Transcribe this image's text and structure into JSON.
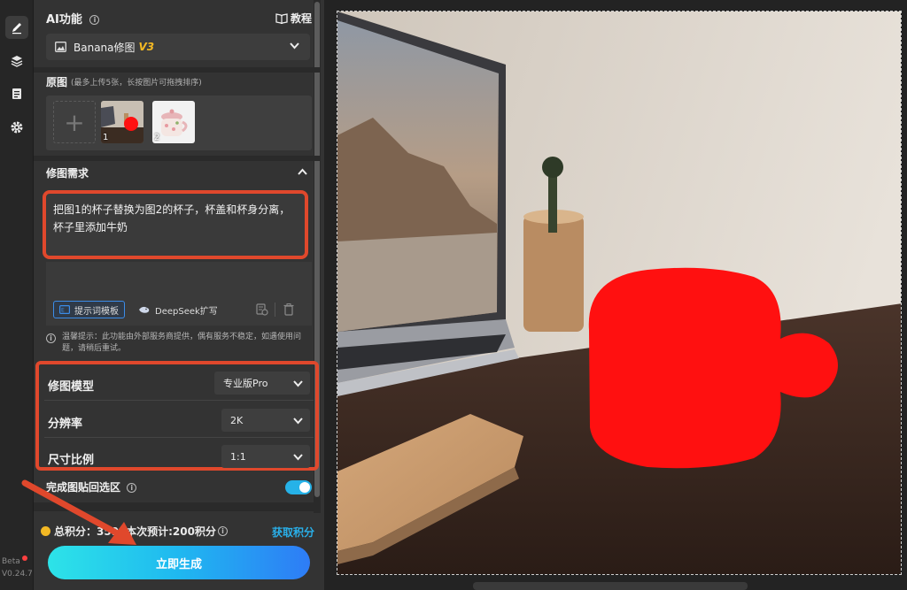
{
  "rail": {
    "items": [
      {
        "icon": "pencil-icon",
        "active": true
      },
      {
        "icon": "layers-icon",
        "active": false
      },
      {
        "icon": "clipboard-icon",
        "active": false
      },
      {
        "icon": "gear-icon",
        "active": false
      }
    ],
    "beta": "Beta",
    "version": "V0.24.7"
  },
  "ai": {
    "title": "AI功能",
    "tutorial": "教程",
    "model_name": "Banana修图",
    "model_version": "V3"
  },
  "source": {
    "title": "原图",
    "hint": "(最多上传5张，长按图片可拖拽排序)",
    "thumbs": [
      {
        "num": "1"
      },
      {
        "num": "2"
      }
    ]
  },
  "request": {
    "title": "修图需求",
    "text": "把图1的杯子替换为图2的杯子，杯盖和杯身分离，杯子里添加牛奶",
    "template_btn": "提示词模板",
    "deepseek_btn": "DeepSeek扩写"
  },
  "notice": "温馨提示：此功能由外部服务商提供，偶有服务不稳定，如遇使用问题，请稍后重试。",
  "settings": {
    "model_label": "修图模型",
    "model_value": "专业版Pro",
    "resolution_label": "分辨率",
    "resolution_value": "2K",
    "ratio_label": "尺寸比例",
    "ratio_value": "1:1"
  },
  "toggle": {
    "label": "完成图贴回选区",
    "on": true
  },
  "credits": {
    "total_label": "总积分：",
    "total_value": "359",
    "estimate": "本次预计:200积分",
    "get_label": "获取积分"
  },
  "generate_label": "立即生成",
  "colors": {
    "accent_red": "#e0482c",
    "accent_blue": "#29b0ea",
    "coin": "#f2b824",
    "model_version": "#f5b923"
  }
}
